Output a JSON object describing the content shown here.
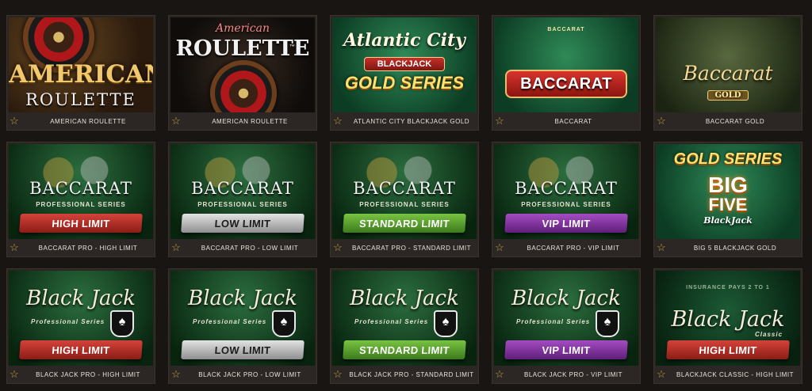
{
  "colors": {
    "star": "#c9a43a",
    "caption_text": "#e9e4d9",
    "tile_bg": "#2a2521"
  },
  "icons": {
    "favorite": "star-icon"
  },
  "games": [
    {
      "caption": "AMERICAN ROULETTE",
      "art": {
        "line1": "AMERICAN",
        "line2": "ROULETTE"
      }
    },
    {
      "caption": "AMERICAN ROULETTE",
      "art": {
        "line1": "American",
        "line2": "ROULETTE",
        "tm": "™"
      }
    },
    {
      "caption": "ATLANTIC CITY BLACKJACK GOLD",
      "art": {
        "line1": "Atlantic City",
        "line2": "BLACKJACK",
        "line3": "GOLD SERIES"
      }
    },
    {
      "caption": "BACCARAT",
      "art": {
        "line1": "BACCARAT",
        "table_label": "BACCARAT"
      }
    },
    {
      "caption": "BACCARAT GOLD",
      "art": {
        "line1": "Baccarat",
        "line2": "GOLD"
      }
    },
    {
      "caption": "BACCARAT PRO - HIGH LIMIT",
      "art": {
        "line1": "BACCARAT",
        "line2": "PROFESSIONAL SERIES",
        "ribbon": "HIGH LIMIT"
      }
    },
    {
      "caption": "BACCARAT PRO - LOW LIMIT",
      "art": {
        "line1": "BACCARAT",
        "line2": "PROFESSIONAL SERIES",
        "ribbon": "LOW LIMIT"
      }
    },
    {
      "caption": "BACCARAT PRO - STANDARD LIMIT",
      "art": {
        "line1": "BACCARAT",
        "line2": "PROFESSIONAL SERIES",
        "ribbon": "STANDARD LIMIT"
      }
    },
    {
      "caption": "BACCARAT PRO - VIP LIMIT",
      "art": {
        "line1": "BACCARAT",
        "line2": "PROFESSIONAL SERIES",
        "ribbon": "VIP LIMIT"
      }
    },
    {
      "caption": "BIG 5 BLACKJACK GOLD",
      "art": {
        "line1": "GOLD SERIES",
        "line2": "BIG",
        "line3": "FIVE",
        "line4": "BlackJack"
      }
    },
    {
      "caption": "BLACK JACK PRO - HIGH LIMIT",
      "art": {
        "line1": "Black Jack",
        "line2": "Professional Series",
        "ribbon": "HIGH LIMIT"
      }
    },
    {
      "caption": "BLACK JACK PRO - LOW LIMIT",
      "art": {
        "line1": "Black Jack",
        "line2": "Professional Series",
        "ribbon": "LOW LIMIT"
      }
    },
    {
      "caption": "BLACK JACK PRO - STANDARD LIMIT",
      "art": {
        "line1": "Black Jack",
        "line2": "Professional Series",
        "ribbon": "STANDARD LIMIT"
      }
    },
    {
      "caption": "BLACK JACK PRO - VIP LIMIT",
      "art": {
        "line1": "Black Jack",
        "line2": "Professional Series",
        "ribbon": "VIP LIMIT"
      }
    },
    {
      "caption": "BLACKJACK CLASSIC - HIGH LIMIT",
      "art": {
        "line1": "Black Jack",
        "line2": "Classic",
        "ribbon": "HIGH LIMIT",
        "table_text": "INSURANCE PAYS 2 TO 1"
      }
    }
  ]
}
